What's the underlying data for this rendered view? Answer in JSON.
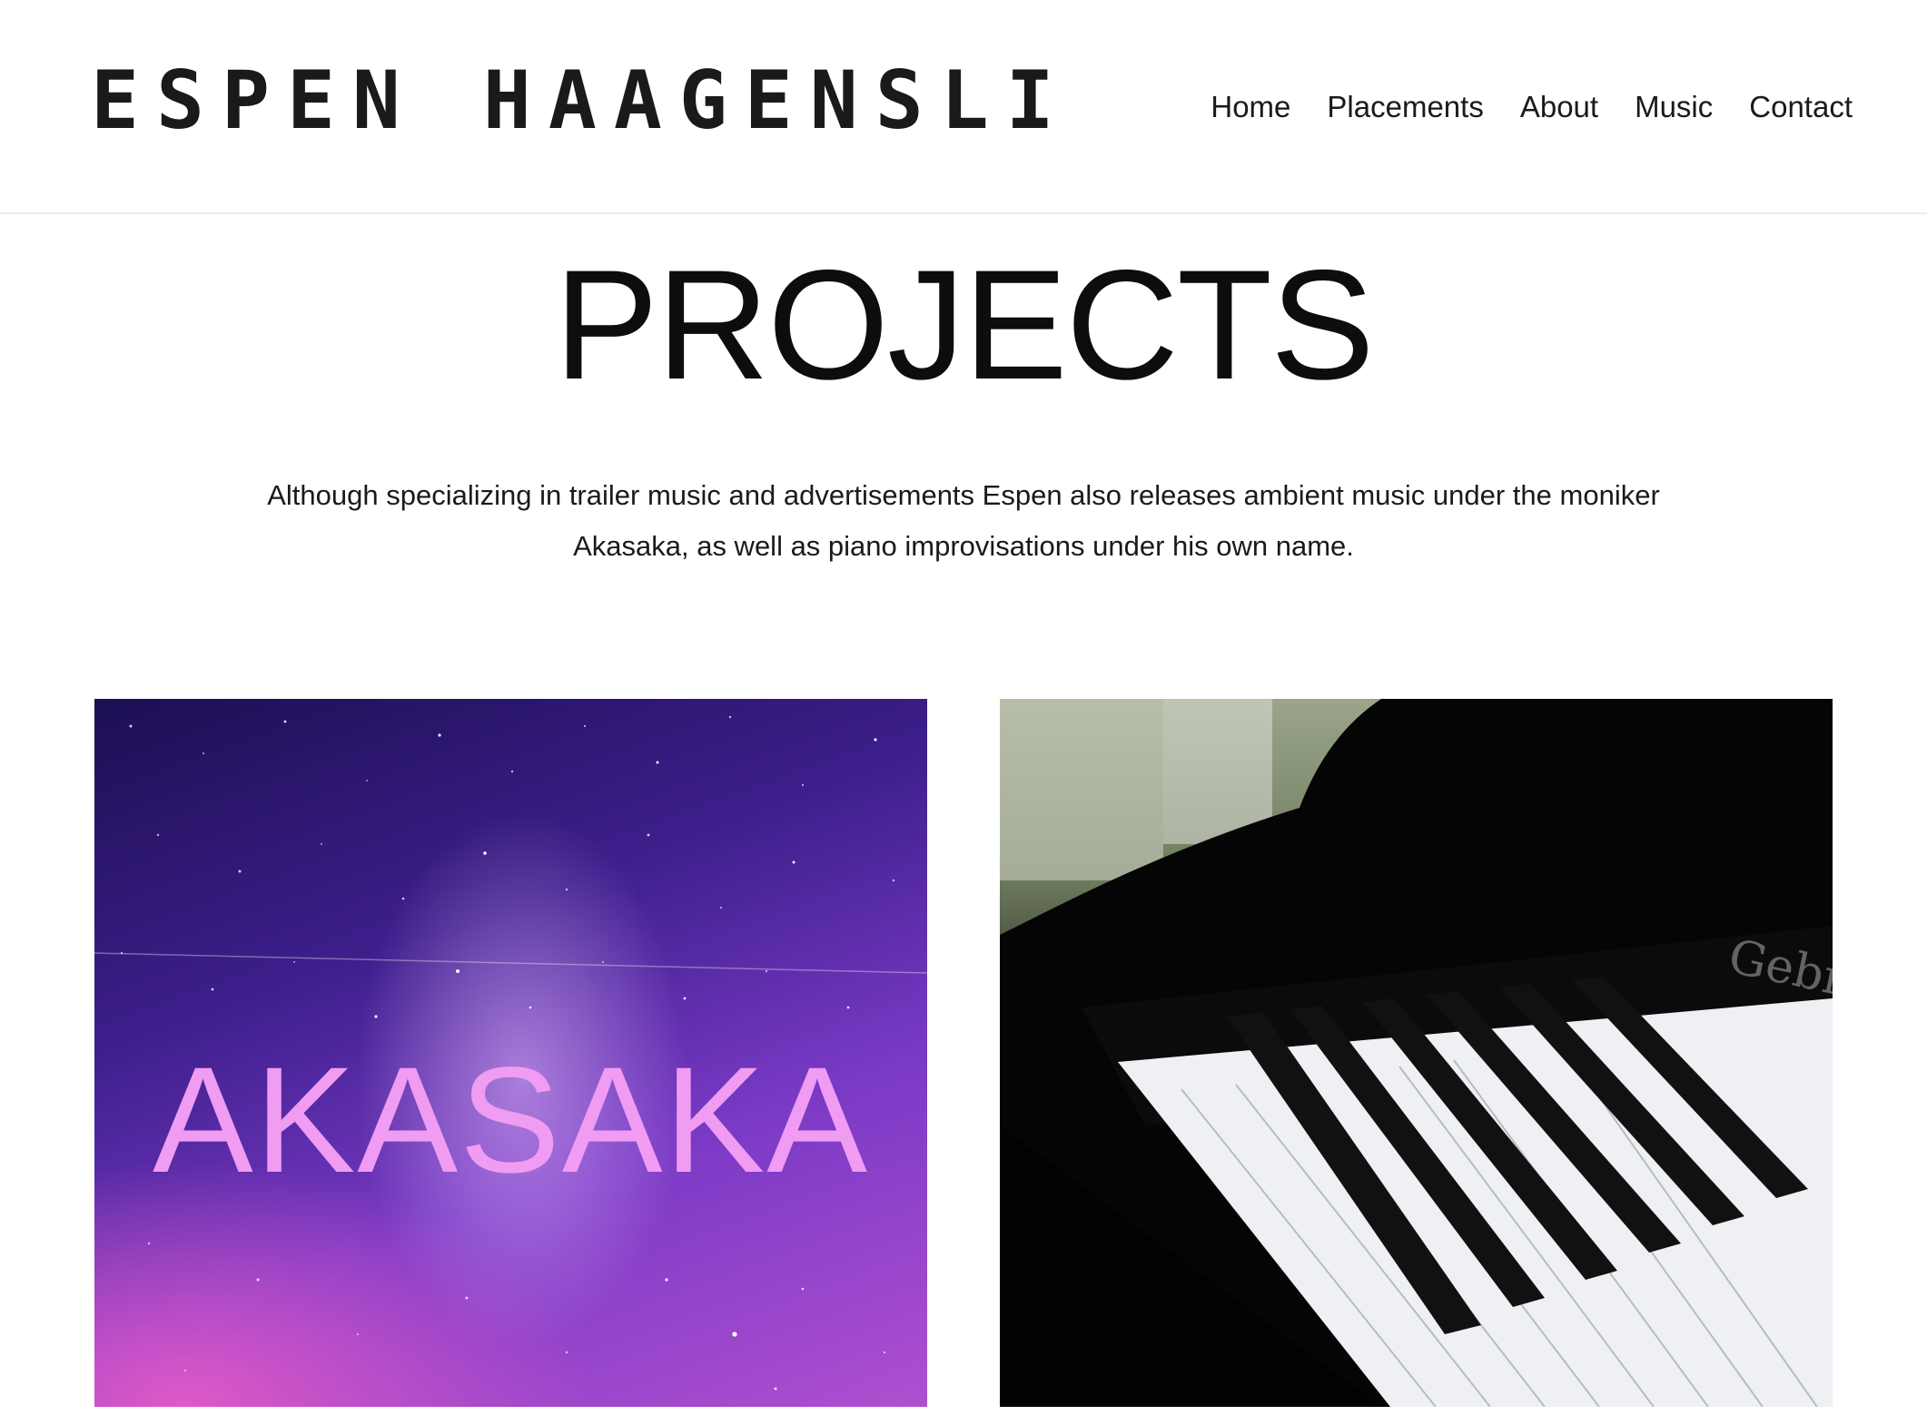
{
  "header": {
    "logo_text": "ESPEN HAAGENSLI",
    "nav": [
      {
        "label": "Home"
      },
      {
        "label": "Placements"
      },
      {
        "label": "About"
      },
      {
        "label": "Music"
      },
      {
        "label": "Contact"
      }
    ]
  },
  "main": {
    "title": "PROJECTS",
    "intro_line1": "Although specializing in trailer music and advertisements Espen also releases ambient music under the moniker",
    "intro_line2": "Akasaka, as well as piano improvisations under his own name.",
    "projects": [
      {
        "overlay_text": "AKASAKA",
        "image": "galaxy-night-sky"
      },
      {
        "image": "grand-piano-keys",
        "brand_text": "Gebr. Ne"
      }
    ]
  },
  "colors": {
    "akasaka_text": "#ef9cf2",
    "galaxy_dark": "#1c0f52",
    "galaxy_mid": "#7a3ac6",
    "galaxy_pink": "#e45ac8"
  }
}
